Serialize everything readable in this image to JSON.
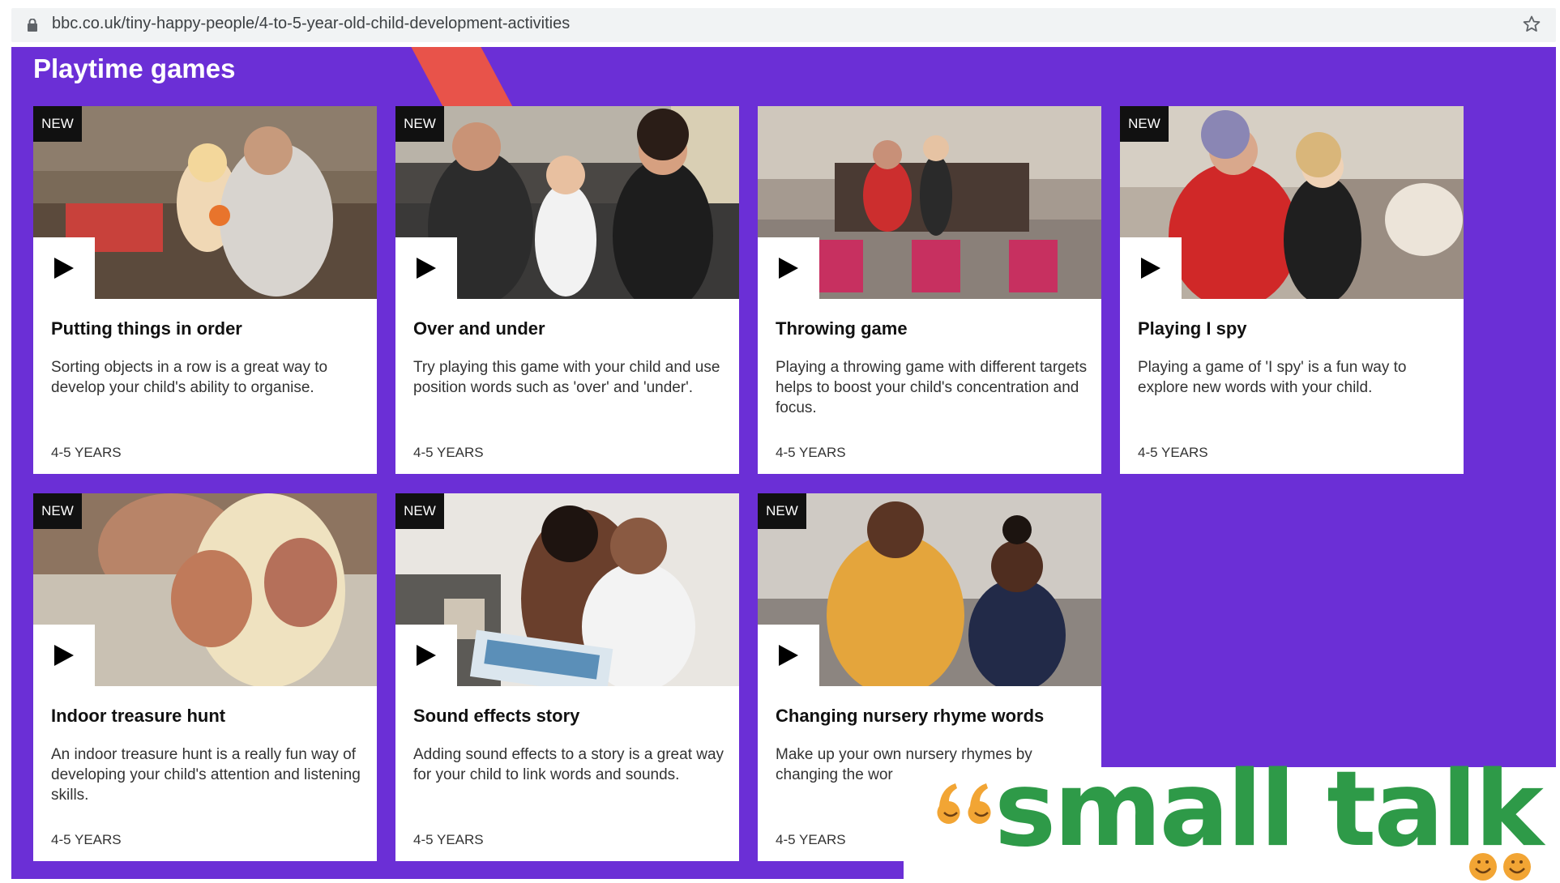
{
  "browser": {
    "url": "bbc.co.uk/tiny-happy-people/4-to-5-year-old-child-development-activities"
  },
  "section": {
    "title": "Playtime games"
  },
  "cards": [
    {
      "badge": "NEW",
      "title": "Putting things in order",
      "description": "Sorting objects in a row is a great way to develop your child's ability to organise.",
      "age": "4-5 YEARS"
    },
    {
      "badge": "NEW",
      "title": "Over and under",
      "description": "Try playing this game with your child and use position words such as 'over' and 'under'.",
      "age": "4-5 YEARS"
    },
    {
      "badge": "",
      "title": "Throwing game",
      "description": "Playing a throwing game with different targets helps to boost your child's concentration and focus.",
      "age": "4-5 YEARS"
    },
    {
      "badge": "NEW",
      "title": "Playing I spy",
      "description": "Playing a game of 'I spy' is a fun way to explore new words with your child.",
      "age": "4-5 YEARS"
    },
    {
      "badge": "NEW",
      "title": "Indoor treasure hunt",
      "description": "An indoor treasure hunt is a really fun way of developing your child's attention and listening skills.",
      "age": "4-5 YEARS"
    },
    {
      "badge": "NEW",
      "title": "Sound effects story",
      "description": "Adding sound effects to a story is a great way for your child to link words and sounds.",
      "age": "4-5 YEARS"
    },
    {
      "badge": "NEW",
      "title": "Changing nursery rhyme words",
      "description": "Make up your own nursery rhymes by changing the wor",
      "age": "4-5 YEARS"
    }
  ],
  "overlay": {
    "logo_text": "small talk"
  },
  "colors": {
    "page_background": "#6b2fd6",
    "accent_stripe": "#e8534a",
    "logo_green": "#2e9a48",
    "badge_background": "#111111"
  }
}
